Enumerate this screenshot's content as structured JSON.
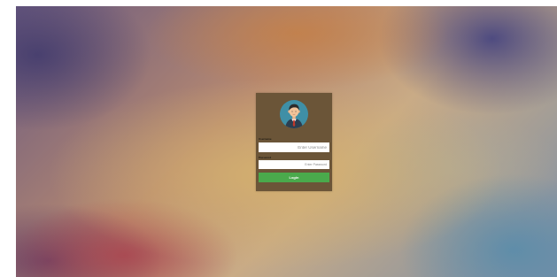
{
  "login": {
    "username": {
      "label": "Username",
      "placeholder": "Enter Username",
      "value": ""
    },
    "password": {
      "label": "Password",
      "placeholder": "Enter Password",
      "value": ""
    },
    "submit_label": "Login"
  },
  "icons": {
    "avatar": "user-avatar-icon"
  },
  "colors": {
    "card_background": "#6b5538",
    "button_background": "#4aaa4c",
    "avatar_circle": "#3f8fa6",
    "button_text": "#ffffff"
  }
}
